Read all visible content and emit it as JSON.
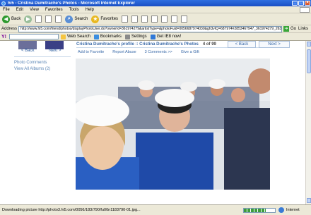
{
  "window": {
    "title": "hi5 - Cristina Dumitrache's Photos - Microsoft Internet Explorer",
    "min": "_",
    "max": "□",
    "close": "×"
  },
  "menu": [
    "File",
    "Edit",
    "View",
    "Favorites",
    "Tools",
    "Help"
  ],
  "toolbar": {
    "back": "Back",
    "search": "Search",
    "favorites": "Favorites"
  },
  "address": {
    "label": "Address",
    "url": "http://www.hi5.com/friend/photos/displayPhotoUser.do?ownerId=361974279&artistType=&photoFuid=0056687974030&gh3vIQ=687974#2853467947_361974279_26351",
    "go": "Go",
    "links": "Links"
  },
  "yahoo": {
    "logo": "Y!",
    "web_search": "Web Search",
    "bookmarks": "Bookmarks",
    "settings": "Settings",
    "ie7": "Get IE8 now!"
  },
  "page": {
    "left": {
      "back": "< Back",
      "next": "Next >",
      "photo_comments": "Photo Comments",
      "view_albums": "View All Albums (2)"
    },
    "header": {
      "owner": "Cristina Dumitrache's profile  ::  Cristina Dumitrache's Photos",
      "count": "4 of 99",
      "back_btn": "< Back",
      "next_btn": "Next >"
    },
    "actions": [
      "Add to Favorite",
      "Report Abuse",
      "3 Comments >>",
      "Give a Gift"
    ]
  },
  "status": {
    "text": "Downloading picture http://photo3.hi5.com/0056/183/790/fu00n1183790-01.jpg...",
    "progress": 0.7,
    "zone": "Internet"
  }
}
